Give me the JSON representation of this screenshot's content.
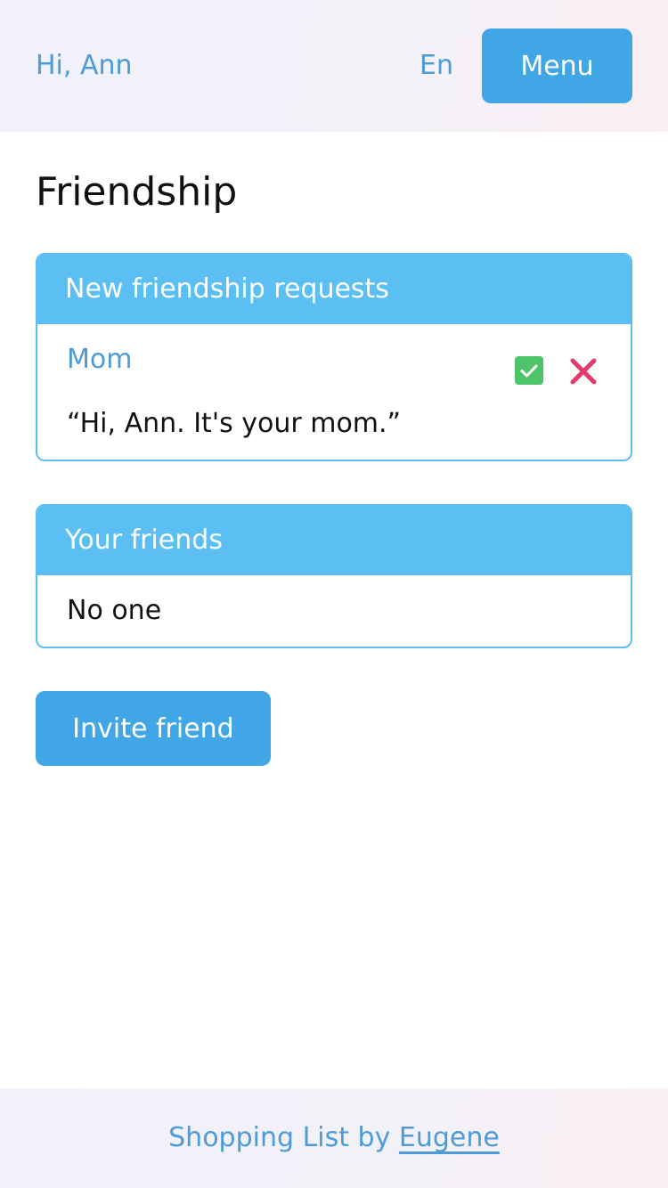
{
  "header": {
    "greeting": "Hi, Ann",
    "language": "En",
    "menu_label": "Menu"
  },
  "page": {
    "title": "Friendship"
  },
  "requests": {
    "heading": "New friendship requests",
    "items": [
      {
        "name": "Mom",
        "message": "“Hi, Ann. It's your mom.”",
        "accept_icon": "check-square-icon",
        "reject_icon": "cross-icon"
      }
    ]
  },
  "friends": {
    "heading": "Your friends",
    "empty_text": "No one"
  },
  "invite": {
    "label": "Invite friend"
  },
  "footer": {
    "text": "Shopping List by ",
    "author": "Eugene"
  },
  "colors": {
    "accent": "#40a6e6",
    "card_header": "#5bbff4",
    "link": "#4d9bd8",
    "accept": "#4cc56a",
    "reject": "#e23a6a"
  }
}
